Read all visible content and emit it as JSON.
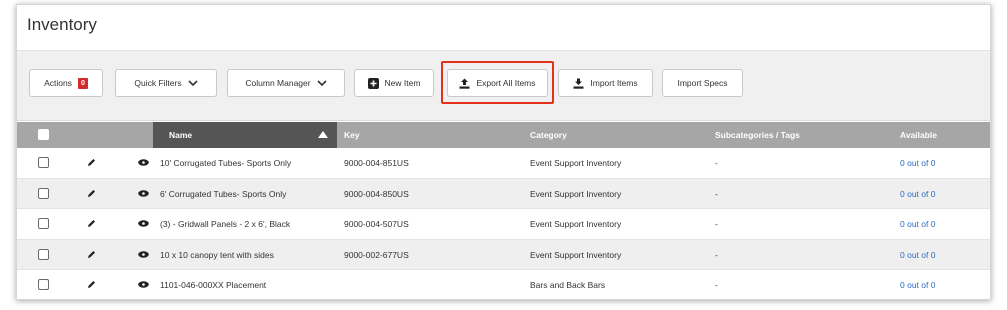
{
  "page": {
    "title": "Inventory"
  },
  "toolbar": {
    "actions_label": "Actions",
    "actions_count": "0",
    "quick_filters_label": "Quick Filters",
    "column_manager_label": "Column Manager",
    "new_item_label": "New Item",
    "export_all_label": "Export All Items",
    "import_items_label": "Import Items",
    "import_specs_label": "Import Specs"
  },
  "colors": {
    "highlight": "#e5301c",
    "badge": "#d22b2b",
    "link": "#2a6cc4",
    "header_bg": "#a6a6a6",
    "sorted_header_bg": "#555555"
  },
  "table": {
    "columns": {
      "name": "Name",
      "key": "Key",
      "category": "Category",
      "subcategories": "Subcategories / Tags",
      "available": "Available"
    },
    "rows": [
      {
        "name": "10' Corrugated Tubes- Sports Only",
        "key": "9000-004-851US",
        "category": "Event Support Inventory",
        "subcategories": "-",
        "available": "0 out of 0"
      },
      {
        "name": "6' Corrugated Tubes- Sports Only",
        "key": "9000-004-850US",
        "category": "Event Support Inventory",
        "subcategories": "-",
        "available": "0 out of 0"
      },
      {
        "name": "(3) - Gridwall Panels - 2 x 6', Black",
        "key": "9000-004-507US",
        "category": "Event Support Inventory",
        "subcategories": "-",
        "available": "0 out of 0"
      },
      {
        "name": "10 x 10 canopy tent with sides",
        "key": "9000-002-677US",
        "category": "Event Support Inventory",
        "subcategories": "-",
        "available": "0 out of 0"
      },
      {
        "name": "1101-046-000XX Placement",
        "key": "",
        "category": "Bars and Back Bars",
        "subcategories": "-",
        "available": "0 out of 0"
      }
    ]
  }
}
